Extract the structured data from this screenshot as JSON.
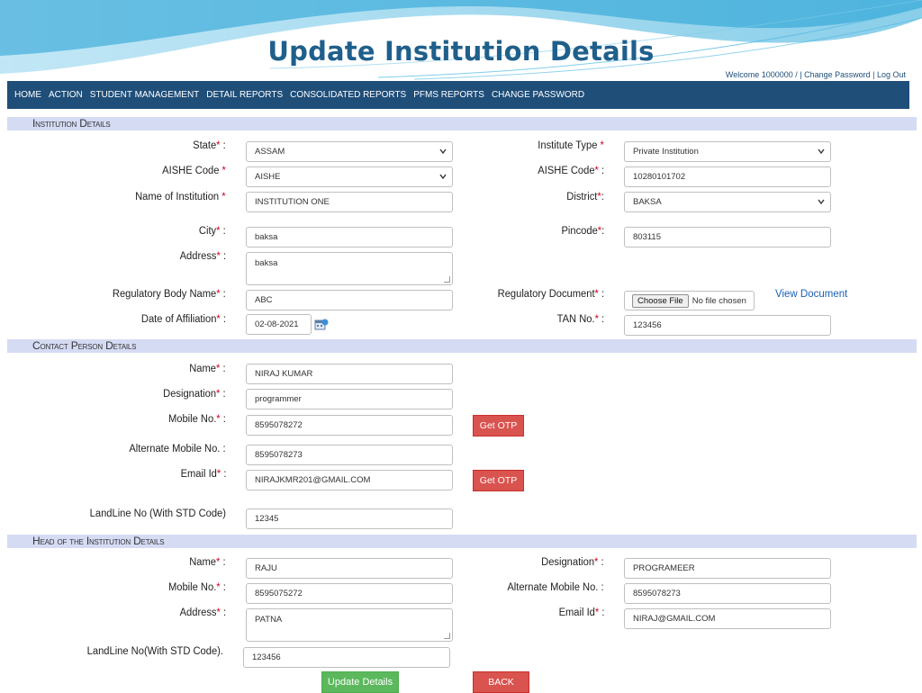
{
  "slide_title": "Update Institution Details",
  "welcome_text": "Welcome 1000000 / | Change Password | Log Out",
  "nav": [
    "HOME",
    "ACTION",
    "STUDENT MANAGEMENT",
    "DETAIL REPORTS",
    "CONSOLIDATED REPORTS",
    "PFMS REPORTS",
    "CHANGE PASSWORD"
  ],
  "sections": {
    "institution": "Institution Details",
    "contact": "Contact Person Details",
    "head": "Head of the Institution Details"
  },
  "institution": {
    "state": {
      "label": "State",
      "suffix": " :",
      "value": "ASSAM"
    },
    "institute_type": {
      "label": "Institute Type",
      "suffix": " ",
      "value": "Private Institution"
    },
    "aishe_code_select": {
      "label": "AISHE Code",
      "suffix": " ",
      "value": "AISHE"
    },
    "aishe_code": {
      "label": "AISHE Code",
      "suffix": " :",
      "value": "10280101702"
    },
    "name": {
      "label": "Name of Institution",
      "suffix": " ",
      "value": "INSTITUTION ONE"
    },
    "district": {
      "label": "District",
      "suffix": ":",
      "value": "BAKSA"
    },
    "city": {
      "label": "City",
      "suffix": " :",
      "value": "baksa"
    },
    "pincode": {
      "label": "Pincode",
      "suffix": ":",
      "value": "803115"
    },
    "address": {
      "label": "Address",
      "suffix": " :",
      "value": "baksa"
    },
    "regulatory_body": {
      "label": "Regulatory Body Name",
      "suffix": " :",
      "value": "ABC"
    },
    "regulatory_document": {
      "label": "Regulatory Document",
      "suffix": " :",
      "button": "Choose File",
      "status": "No file chosen",
      "link": "View Document"
    },
    "date_of_affiliation": {
      "label": "Date of Affiliation",
      "suffix": " :",
      "value": "02-08-2021"
    },
    "tan_no": {
      "label": "TAN No.",
      "suffix": " :",
      "value": "123456"
    }
  },
  "contact": {
    "name": {
      "label": "Name",
      "suffix": " :",
      "value": "NIRAJ KUMAR"
    },
    "designation": {
      "label": "Designation",
      "suffix": " :",
      "value": "programmer"
    },
    "mobile": {
      "label": "Mobile No.",
      "suffix": " :",
      "value": "8595078272",
      "button": "Get OTP"
    },
    "alt_mobile": {
      "label": "Alternate Mobile No. :",
      "value": "8595078273"
    },
    "email": {
      "label": "Email Id",
      "suffix": " :",
      "value": "NIRAJKMR201@GMAIL.COM",
      "button": "Get OTP"
    },
    "landline": {
      "label": "LandLine No (With STD Code)",
      "value": "12345"
    }
  },
  "head": {
    "name": {
      "label": "Name",
      "suffix": " :",
      "value": "RAJU"
    },
    "designation": {
      "label": "Designation",
      "suffix": " :",
      "value": "PROGRAMEER"
    },
    "mobile": {
      "label": "Mobile No.",
      "suffix": " :",
      "value": "8595075272"
    },
    "alt_mobile": {
      "label": "Alternate Mobile No. :",
      "value": "8595078273"
    },
    "address": {
      "label": "Address",
      "suffix": " :",
      "value": "PATNA"
    },
    "email": {
      "label": "Email Id",
      "suffix": " :",
      "value": "NIRAJ@GMAIL.COM"
    },
    "landline": {
      "label": "LandLine No(With STD Code).",
      "value": "123456"
    }
  },
  "buttons": {
    "update": "Update Details",
    "back": "BACK"
  },
  "colors": {
    "navbar": "#1f4e79",
    "section": "#d6dbf4",
    "required": "#d0021b",
    "danger": "#d9534f",
    "success": "#5cb85c",
    "title": "#1f5f8b"
  }
}
